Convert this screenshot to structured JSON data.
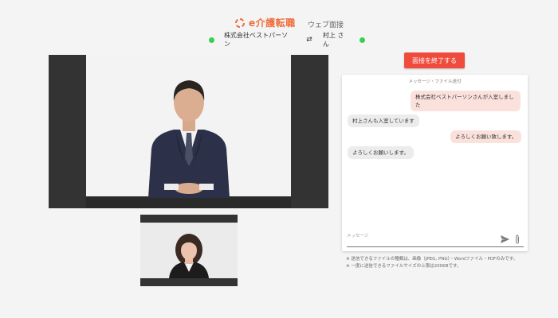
{
  "header": {
    "logo_text": "e介護転職",
    "subtitle": "ウェブ面接",
    "brand_color": "#ef6e3c"
  },
  "participants": {
    "left_name": "株式会社ベストパーソン",
    "right_name": "村上 さん",
    "swap_symbol": "⇄",
    "status_color": "#3ccf4e"
  },
  "end_button": {
    "label": "面接を終了する",
    "color": "#ef4c3e"
  },
  "chat": {
    "title": "メッセージ・ファイル送付",
    "messages": [
      {
        "direction": "out",
        "text": "株式会社ベストパーソンさんが入室しました"
      },
      {
        "direction": "in",
        "text": "村上さんも入室しています"
      },
      {
        "direction": "out",
        "text": "よろしくお願い致します。"
      },
      {
        "direction": "in",
        "text": "よろしくお願いします。"
      }
    ],
    "input_placeholder": "メッセージ",
    "send_icon": "send-icon",
    "attach_icon": "paperclip-icon"
  },
  "notes": [
    "※ 送信できるファイルの種類は、画像（JPEG, PNG）・Wordファイル・PDFのみです。",
    "※ 一度に送信できるファイルサイズの上限は200KBです。"
  ]
}
